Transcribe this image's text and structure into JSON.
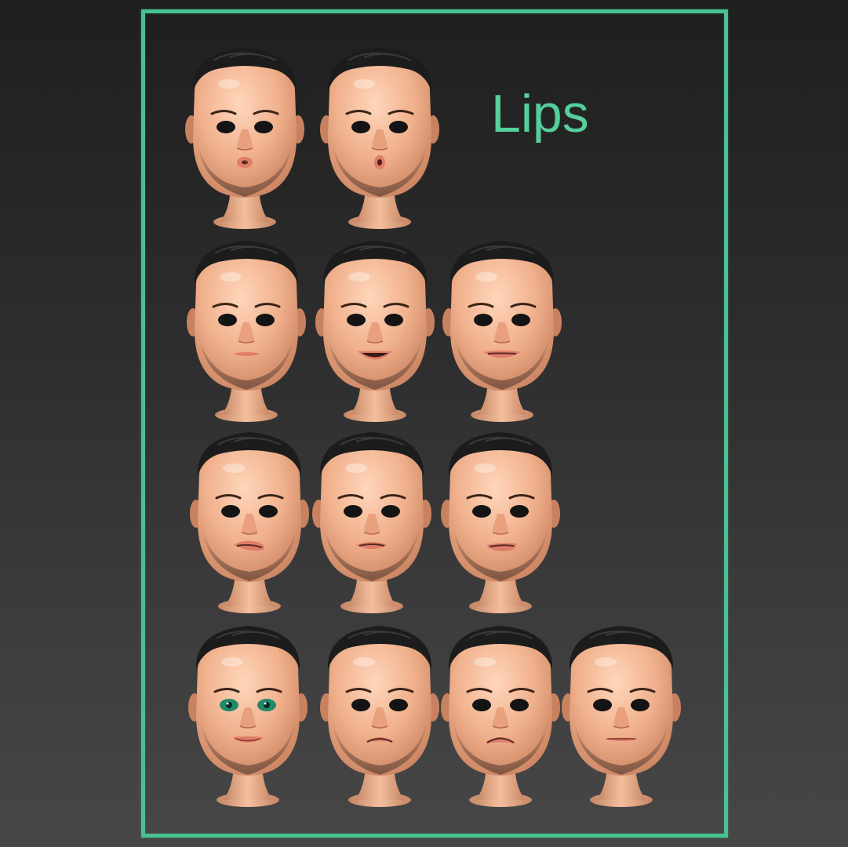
{
  "frame": {
    "title": "Lips",
    "accent_color": "#47c290",
    "title_color": "#55cf9c"
  },
  "heads": [
    {
      "row": 1,
      "col": 1,
      "mouth": "pucker",
      "eyes": "dark"
    },
    {
      "row": 1,
      "col": 2,
      "mouth": "oo",
      "eyes": "dark"
    },
    {
      "row": 2,
      "col": 1,
      "mouth": "neutral-thin",
      "eyes": "dark"
    },
    {
      "row": 2,
      "col": 2,
      "mouth": "smile-open",
      "eyes": "dark"
    },
    {
      "row": 2,
      "col": 3,
      "mouth": "smile-wide",
      "eyes": "dark"
    },
    {
      "row": 3,
      "col": 1,
      "mouth": "sneer-left",
      "eyes": "dark"
    },
    {
      "row": 3,
      "col": 2,
      "mouth": "sneer-center",
      "eyes": "dark"
    },
    {
      "row": 3,
      "col": 3,
      "mouth": "sneer-right",
      "eyes": "dark"
    },
    {
      "row": 4,
      "col": 1,
      "mouth": "smile-soft",
      "eyes": "green"
    },
    {
      "row": 4,
      "col": 2,
      "mouth": "frown",
      "eyes": "dark"
    },
    {
      "row": 4,
      "col": 3,
      "mouth": "frown-deep",
      "eyes": "dark"
    },
    {
      "row": 4,
      "col": 4,
      "mouth": "neutral-wide",
      "eyes": "dark"
    }
  ],
  "colors": {
    "skin": "#f0b08c",
    "skin_shadow": "#c9825f",
    "hair": "#1c1c1c",
    "beard": "#6b4a3a",
    "lips": "#e07d6a",
    "eye_dark": "#141414",
    "eye_green": "#1f8a6b"
  }
}
